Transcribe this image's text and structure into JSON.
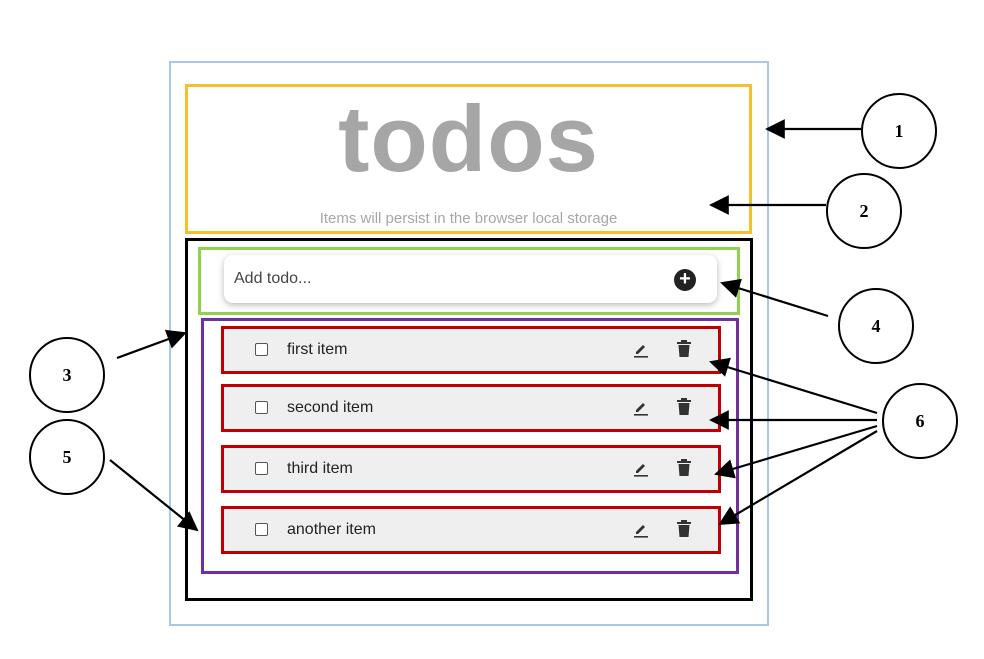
{
  "header": {
    "title": "todos",
    "subtitle": "Items will persist in the browser local storage"
  },
  "add_form": {
    "placeholder": "Add todo...",
    "button_icon": "plus-circle-icon",
    "button_glyph": "+"
  },
  "items": [
    {
      "label": "first item"
    },
    {
      "label": "second item"
    },
    {
      "label": "third item"
    },
    {
      "label": "another item"
    }
  ],
  "item_icons": {
    "edit": "pencil-icon",
    "delete": "trash-icon"
  },
  "callouts": [
    "1",
    "2",
    "3",
    "4",
    "5",
    "6"
  ],
  "colors": {
    "outer_border": "#a9c7e6",
    "header_border": "#f4c02c",
    "main_border": "#000000",
    "input_border": "#92d050",
    "list_border": "#7030a0",
    "item_border": "#c00000",
    "title_text": "#a6a6a6"
  }
}
